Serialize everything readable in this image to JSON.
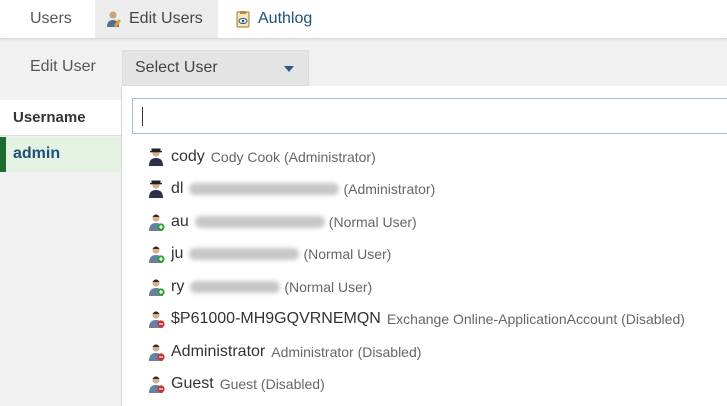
{
  "nav": {
    "tabs": [
      {
        "label": "Users",
        "icon": ""
      },
      {
        "label": "Edit Users",
        "icon": "user-edit-icon"
      },
      {
        "label": "Authlog",
        "icon": "log-eye-icon"
      }
    ]
  },
  "edit_user": {
    "label": "Edit User",
    "select_value": "Select User"
  },
  "table": {
    "header": "Username",
    "rows": [
      "admin"
    ]
  },
  "dropdown": {
    "search_value": "",
    "options": [
      {
        "name": "cody",
        "desc": "Cody Cook (Administrator)",
        "role": "admin"
      },
      {
        "name": "dl",
        "desc": "(Administrator)",
        "role": "admin"
      },
      {
        "name": "au",
        "desc": "(Normal User)",
        "role": "normal"
      },
      {
        "name": "ju",
        "desc": "(Normal User)",
        "role": "normal"
      },
      {
        "name": "ry",
        "desc": "(Normal User)",
        "role": "normal"
      },
      {
        "name": "$P61000-MH9GQVRNEMQN",
        "desc": "Exchange Online-ApplicationAccount (Disabled)",
        "role": "disabled"
      },
      {
        "name": "Administrator",
        "desc": "Administrator (Disabled)",
        "role": "disabled"
      },
      {
        "name": "Guest",
        "desc": "Guest (Disabled)",
        "role": "disabled"
      }
    ]
  },
  "colors": {
    "accent": "#1f4f7a",
    "active_border": "#1d6b2e",
    "active_bg": "#e3f2e3"
  }
}
